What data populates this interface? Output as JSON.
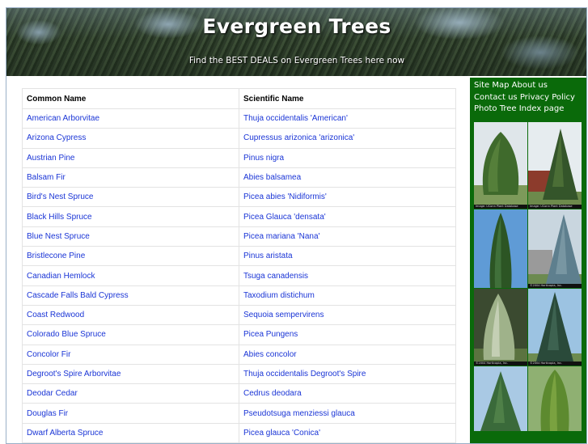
{
  "header": {
    "title": "Evergreen Trees",
    "tagline": "Find the BEST DEALS on Evergreen Trees here now"
  },
  "table": {
    "headers": [
      "Common Name",
      "Scientific Name"
    ],
    "rows": [
      [
        "American Arborvitae",
        "Thuja occidentalis 'American'"
      ],
      [
        "Arizona Cypress",
        "Cupressus arizonica 'arizonica'"
      ],
      [
        "Austrian Pine",
        "Pinus nigra"
      ],
      [
        "Balsam Fir",
        "Abies balsamea"
      ],
      [
        "Bird's Nest Spruce",
        "Picea abies 'Nidiformis'"
      ],
      [
        "Black Hills Spruce",
        "Picea Glauca 'densata'"
      ],
      [
        "Blue Nest Spruce",
        "Picea mariana 'Nana'"
      ],
      [
        "Bristlecone Pine",
        "Pinus aristata"
      ],
      [
        "Canadian Hemlock",
        "Tsuga canadensis"
      ],
      [
        "Cascade Falls Bald Cypress",
        "Taxodium distichum"
      ],
      [
        "Coast Redwood",
        "Sequoia sempervirens"
      ],
      [
        "Colorado Blue Spruce",
        "Picea Pungens"
      ],
      [
        "Concolor Fir",
        "Abies concolor"
      ],
      [
        "Degroot's Spire Arborvitae",
        "Thuja occidentalis Degroot's Spire"
      ],
      [
        "Deodar Cedar",
        "Cedrus deodara"
      ],
      [
        "Douglas Fir",
        "Pseudotsuga menziessi glauca"
      ],
      [
        "Dwarf Alberta Spruce",
        "Picea glauca 'Conica'"
      ]
    ]
  },
  "sidebar": {
    "site_map": "Site Map",
    "about_us": "About us",
    "contact_us": "Contact us",
    "privacy_policy": "Privacy Policy",
    "photo_tree_index": "Photo Tree Index page",
    "photo_captions": [
      "Image: UConn Plant Database",
      "Image: UConn Plant Database",
      "",
      "©2004 Horticopia, Inc.",
      "©2004 Horticopia, Inc.",
      "©2004 Horticopia, Inc.",
      "",
      ""
    ]
  },
  "colors": {
    "sidebar_bg": "#0a6a0a",
    "link": "#1a35d6",
    "table_border": "#e3e3e3"
  }
}
